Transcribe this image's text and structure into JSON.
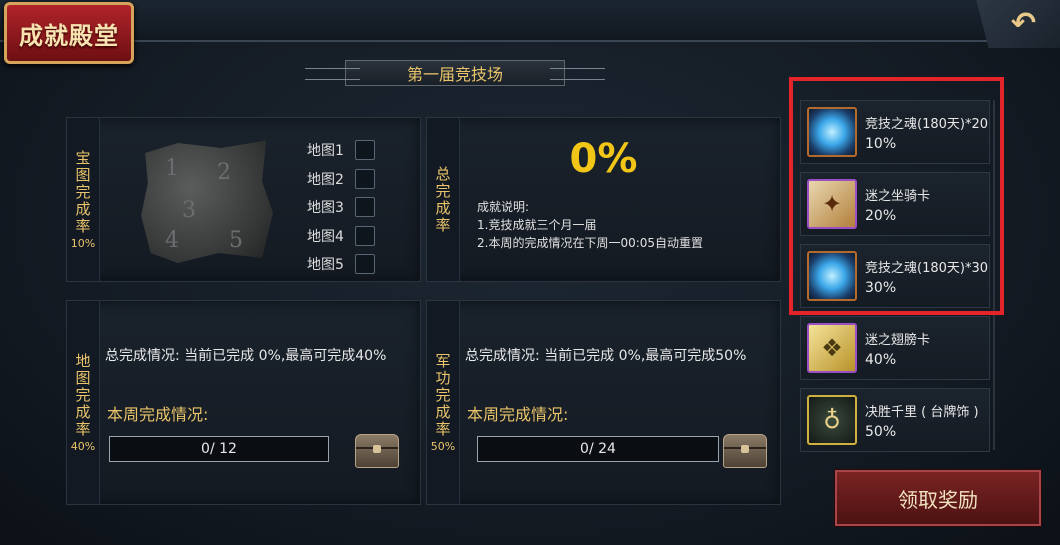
{
  "header": {
    "badge_title": "成就殿堂",
    "back_icon": "back-arrow-icon"
  },
  "season_title": "第一届竞技场",
  "treasure_panel": {
    "label": "宝图完成率",
    "percent": "10%",
    "maps": [
      "地图1",
      "地图2",
      "地图3",
      "地图4",
      "地图5"
    ],
    "map_numbers": [
      "1",
      "2",
      "3",
      "4",
      "5"
    ]
  },
  "total_panel": {
    "label": "总完成率",
    "percent": "0%",
    "desc_title": "成就说明:",
    "desc_lines": [
      "1.竞技成就三个月一届",
      "2.本周的完成情况在下周一00:05自动重置"
    ]
  },
  "map_panel": {
    "label": "地图完成率",
    "percent": "40%",
    "summary": "总完成情况: 当前已完成 0%,最高可完成40%",
    "week_label": "本周完成情况:",
    "progress_text": "0/ 12"
  },
  "merit_panel": {
    "label": "军功完成率",
    "percent": "50%",
    "summary": "总完成情况: 当前已完成 0%,最高可完成50%",
    "week_label": "本周完成情况:",
    "progress_text": "0/ 24"
  },
  "rewards": [
    {
      "name": "竞技之魂(180天)*20",
      "pct": "10%",
      "icon": "soul-orb-icon"
    },
    {
      "name": "迷之坐骑卡",
      "pct": "20%",
      "icon": "mount-card-icon"
    },
    {
      "name": "竞技之魂(180天)*30",
      "pct": "30%",
      "icon": "soul-orb-icon"
    },
    {
      "name": "迷之翅膀卡",
      "pct": "40%",
      "icon": "wings-card-icon"
    },
    {
      "name": "决胜千里 ( 台牌饰 )",
      "pct": "50%",
      "icon": "ornament-icon"
    }
  ],
  "claim_button": "领取奖励",
  "colors": {
    "accent_gold": "#e9c46a",
    "highlight_red": "#e3242b",
    "percent_yellow": "#f2c617"
  }
}
